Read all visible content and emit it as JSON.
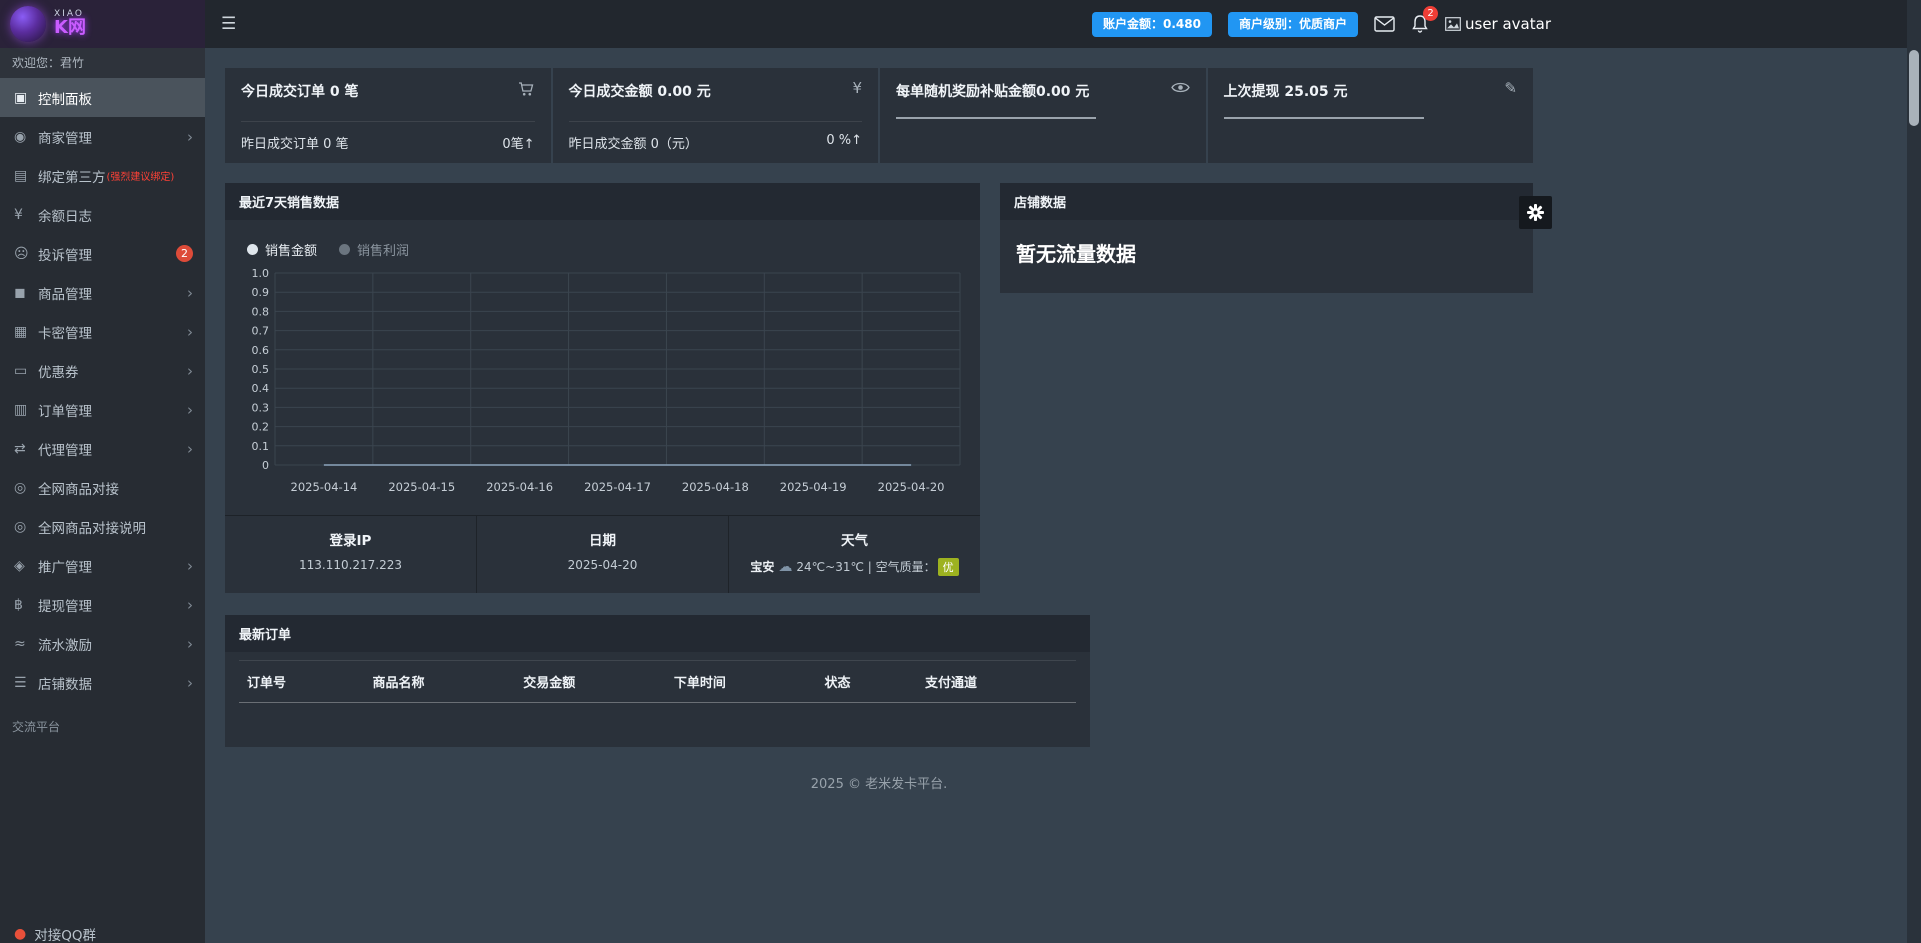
{
  "topbar": {
    "account_balance_label": "账户金额：0.480",
    "merchant_level_label": "商户级别：优质商户",
    "notification_count": "2",
    "avatar_text": "user avatar"
  },
  "sidebar": {
    "logo_top": "XIAO",
    "logo_main": "K网",
    "welcome_text": "欢迎您：君竹",
    "menu": [
      {
        "label": "控制面板",
        "icon": "desktop-icon",
        "active": true
      },
      {
        "label": "商家管理",
        "icon": "users-icon",
        "chevron": true
      },
      {
        "label": "绑定第三方",
        "suffix": "(强烈建议绑定)",
        "icon": "bind-card-icon"
      },
      {
        "label": "余额日志",
        "icon": "balance-yen-icon"
      },
      {
        "label": "投诉管理",
        "icon": "complaint-face-icon",
        "badge": "2"
      },
      {
        "label": "商品管理",
        "icon": "goods-briefcase-icon",
        "chevron": true
      },
      {
        "label": "卡密管理",
        "icon": "cardkey-grid-icon",
        "chevron": true
      },
      {
        "label": "优惠券",
        "icon": "coupon-icon",
        "chevron": true
      },
      {
        "label": "订单管理",
        "icon": "orders-chart-icon",
        "chevron": true
      },
      {
        "label": "代理管理",
        "icon": "agent-exchange-icon",
        "chevron": true
      },
      {
        "label": "全网商品对接",
        "icon": "link-circle-icon"
      },
      {
        "label": "全网商品对接说明",
        "icon": "link-circle-icon"
      },
      {
        "label": "推广管理",
        "icon": "promo-share-icon",
        "chevron": true
      },
      {
        "label": "提现管理",
        "icon": "withdraw-bitcoin-icon",
        "chevron": true
      },
      {
        "label": "流水激励",
        "icon": "flow-water-icon",
        "chevron": true
      },
      {
        "label": "店铺数据",
        "icon": "shop-database-icon",
        "chevron": true
      }
    ],
    "section_title": "交流平台",
    "qq_group_label": "对接QQ群"
  },
  "stat_cards": [
    {
      "title": "今日成交订单 0 笔",
      "icon": "cart-icon",
      "sub_label": "昨日成交订单 0 笔",
      "sub_value": "0笔↑"
    },
    {
      "title": "今日成交金额 0.00 元",
      "icon": "yen-icon",
      "sub_label": "昨日成交金额 0（元）",
      "sub_value": "0 %↑"
    },
    {
      "title": "每单随机奖励补贴金额0.00 元",
      "icon": "eye-icon",
      "underline": true
    },
    {
      "title": "上次提现 25.05 元",
      "icon": "pencil-icon",
      "underline": true
    }
  ],
  "chart_data": {
    "type": "line",
    "title": "最近7天销售数据",
    "x": [
      "2025-04-14",
      "2025-04-15",
      "2025-04-16",
      "2025-04-17",
      "2025-04-18",
      "2025-04-19",
      "2025-04-20"
    ],
    "series": [
      {
        "name": "销售金额",
        "active": true,
        "values": [
          0,
          0,
          0,
          0,
          0,
          0,
          0
        ]
      },
      {
        "name": "销售利润",
        "active": false,
        "values": [
          0,
          0,
          0,
          0,
          0,
          0,
          0
        ]
      }
    ],
    "ylim": [
      0,
      1
    ],
    "y_ticks": [
      0,
      0.1,
      0.2,
      0.3,
      0.4,
      0.5,
      0.6,
      0.7,
      0.8,
      0.9,
      1.0
    ],
    "grid": true,
    "legend_position": "top-left"
  },
  "info_cells": [
    {
      "title": "登录IP",
      "value": "113.110.217.223"
    },
    {
      "title": "日期",
      "value": "2025-04-20"
    },
    {
      "title": "天气",
      "city": "宝安",
      "value": "24℃~31℃ | 空气质量：",
      "badge": "优"
    }
  ],
  "shop_panel": {
    "title": "店铺数据",
    "empty_text": "暂无流量数据"
  },
  "orders_panel": {
    "title": "最新订单",
    "columns": [
      "订单号",
      "商品名称",
      "交易金额",
      "下单时间",
      "状态",
      "支付通道"
    ]
  },
  "footer_text": "2025 © 老米发卡平台.",
  "icons": {
    "topbar": [
      "hamburger-icon",
      "envelope-icon",
      "bell-icon",
      "broken-image-icon"
    ],
    "weather": "cloud-icon",
    "settings": "gear-icon",
    "qq": "qq-icon"
  },
  "colors": {
    "accent_blue": "#2196f3",
    "badge_red": "#dd4b39",
    "aqi_green": "#9db220"
  }
}
